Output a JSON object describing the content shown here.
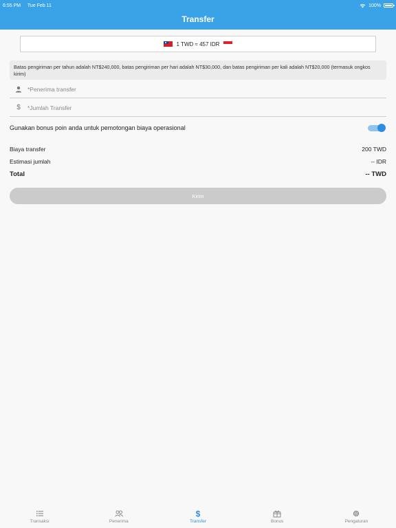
{
  "status_bar": {
    "time": "6:55 PM",
    "date": "Tue Feb 11",
    "battery": "100%"
  },
  "header": {
    "title": "Transfer"
  },
  "rate": {
    "text": "1 TWD ≈ 457 IDR"
  },
  "notice": {
    "text": "Batas pengiriman per tahun adalah NT$240,000, batas pengiriman per hari adalah NT$30,000, dan batas pengiriman per kali adalah NT$20,000 (termasuk ongkos kirim)"
  },
  "form": {
    "recipient_placeholder": "*Penerima transfer",
    "amount_placeholder": "*Jumlah Transfer"
  },
  "bonus": {
    "label": "Gunakan bonus poin anda untuk pemotongan biaya operasional",
    "enabled": true
  },
  "summary": {
    "fee_label": "Biaya transfer",
    "fee_value": "200 TWD",
    "estimate_label": "Estimasi jumlah",
    "estimate_value": "-- IDR",
    "total_label": "Total",
    "total_value": "-- TWD"
  },
  "send_button": {
    "label": "Kirim"
  },
  "tabs": [
    {
      "label": "Transaksi",
      "icon": "list-icon"
    },
    {
      "label": "Penerima",
      "icon": "people-icon"
    },
    {
      "label": "Transfer",
      "icon": "dollar-icon",
      "active": true
    },
    {
      "label": "Bonus",
      "icon": "gift-icon"
    },
    {
      "label": "Pengaturan",
      "icon": "gear-icon"
    }
  ],
  "colors": {
    "header": "#3aa3e8",
    "accent": "#2f8de0",
    "button_disabled": "#cbcbcb"
  }
}
